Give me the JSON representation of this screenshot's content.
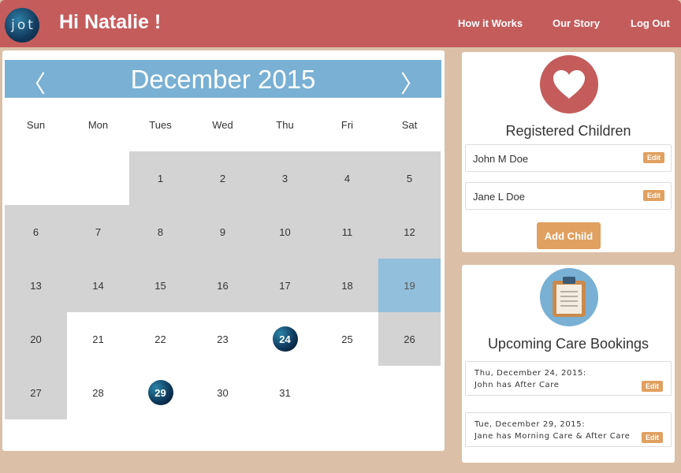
{
  "header": {
    "logo_text": "jot",
    "greeting": "Hi Natalie !",
    "nav": [
      "How it Works",
      "Our Story",
      "Log Out"
    ]
  },
  "calendar": {
    "title": "December 2015",
    "prev_arrow": "〈",
    "next_arrow": "〉",
    "weekdays": [
      "Sun",
      "Mon",
      "Tues",
      "Wed",
      "Thu",
      "Fri",
      "Sat"
    ],
    "days": [
      "1",
      "2",
      "3",
      "4",
      "5",
      "6",
      "7",
      "8",
      "9",
      "10",
      "11",
      "12",
      "13",
      "14",
      "15",
      "16",
      "17",
      "18",
      "19",
      "20",
      "21",
      "22",
      "23",
      "24",
      "25",
      "26",
      "27",
      "28",
      "29",
      "30",
      "31"
    ],
    "booked_days": [
      "24",
      "29"
    ],
    "selected_day": "19"
  },
  "children": {
    "title": "Registered Children",
    "items": [
      {
        "name": "John M Doe",
        "edit": "Edit"
      },
      {
        "name": "Jane L Doe",
        "edit": "Edit"
      }
    ],
    "add_label": "Add Child"
  },
  "bookings": {
    "title": "Upcoming Care Bookings",
    "items": [
      {
        "date": "Thu, December 24, 2015:",
        "detail": "John has After Care",
        "edit": "Edit"
      },
      {
        "date": "Tue, December 29, 2015:",
        "detail": "Jane has Morning Care & After Care",
        "edit": "Edit"
      }
    ]
  },
  "colors": {
    "header": "#c45c5c",
    "background": "#dbbfa6",
    "calendar_header": "#79b0d4",
    "accent_button": "#e0a060"
  },
  "icons": {
    "heart": "heart-icon",
    "clipboard": "clipboard-icon"
  }
}
